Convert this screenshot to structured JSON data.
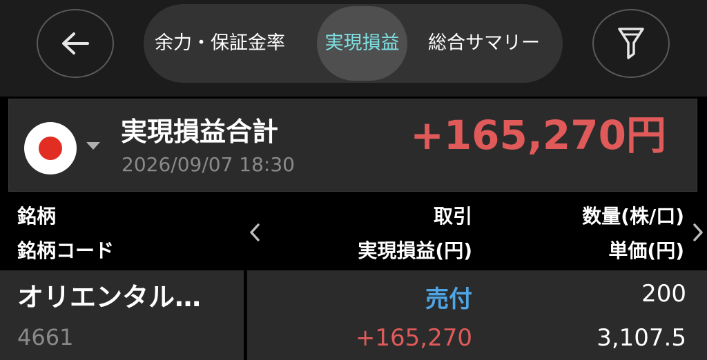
{
  "nav": {
    "back_icon": "arrow-left-icon",
    "filter_icon": "filter-icon",
    "tabs": [
      {
        "label": "余力・保証金率",
        "active": false
      },
      {
        "label": "実現損益",
        "active": true
      },
      {
        "label": "総合サマリー",
        "active": false
      }
    ]
  },
  "summary": {
    "market_icon": "japan-flag-icon",
    "title": "実現損益合計",
    "datetime": "2026/09/07 18:30",
    "total": "+165,270円"
  },
  "table": {
    "headers": {
      "name": "銘柄",
      "code": "銘柄コード",
      "trade": "取引",
      "realized_pl": "実現損益(円)",
      "quantity": "数量(株/口)",
      "unit_price": "単価(円)"
    },
    "rows": [
      {
        "name": "オリエンタル…",
        "code": "4661",
        "trade": "売付",
        "realized_pl": "+165,270",
        "quantity": "200",
        "unit_price": "3,107.5"
      }
    ]
  },
  "colors": {
    "active_tab": "#7fe0e3",
    "profit": "#e05a5a",
    "sell": "#4fa6e6"
  }
}
